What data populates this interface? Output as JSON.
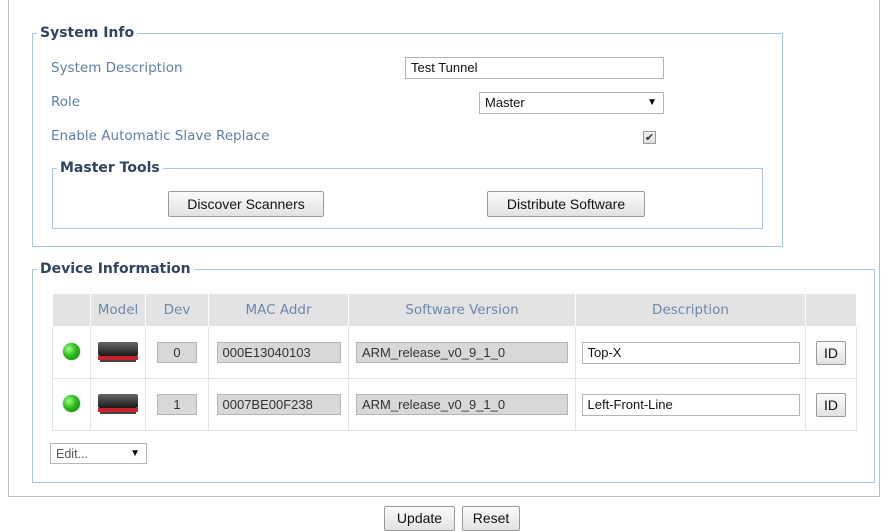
{
  "system_info": {
    "legend": "System Info",
    "description_label": "System Description",
    "description_value": "Test Tunnel",
    "role_label": "Role",
    "role_value": "Master",
    "auto_replace_label": "Enable Automatic Slave Replace",
    "auto_replace_checked": true,
    "checkmark": "✔",
    "dropdown_arrow": "▼"
  },
  "master_tools": {
    "legend": "Master Tools",
    "discover_label": "Discover Scanners",
    "distribute_label": "Distribute Software"
  },
  "device_info": {
    "legend": "Device Information",
    "columns": [
      "",
      "Model",
      "Dev",
      "MAC Addr",
      "Software Version",
      "Description",
      ""
    ],
    "rows": [
      {
        "status": "online-green",
        "model_icon": "scanner-device-icon",
        "dev": "0",
        "mac": "000E13040103",
        "software": "ARM_release_v0_9_1_0",
        "description": "Top-X",
        "id_label": "ID"
      },
      {
        "status": "online-green",
        "model_icon": "scanner-device-icon",
        "dev": "1",
        "mac": "0007BE00F238",
        "software": "ARM_release_v0_9_1_0",
        "description": "Left-Front-Line",
        "id_label": "ID"
      }
    ],
    "edit_select": "Edit..."
  },
  "footer": {
    "update_label": "Update",
    "reset_label": "Reset"
  },
  "colors": {
    "label_blue": "#5a7fa8",
    "legend_navy": "#2e4460",
    "fieldset_border": "#a9c5e0",
    "status_green": "#2fbd1a"
  }
}
